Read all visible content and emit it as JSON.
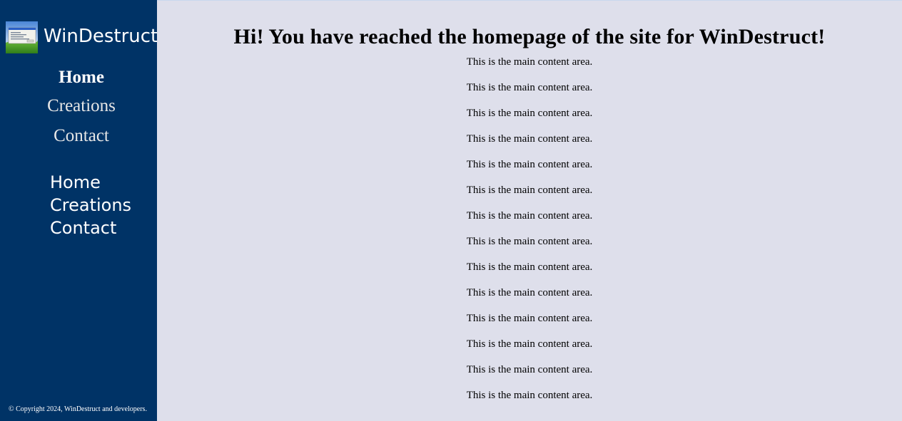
{
  "sidebar": {
    "brand_name": "WinDestruct",
    "logo_icon": "windows-xp-desktop-screenshot-logo",
    "background": "#003366",
    "nav_primary": [
      {
        "label": "Home",
        "active": true
      },
      {
        "label": "Creations",
        "active": false
      },
      {
        "label": "Contact",
        "active": false
      }
    ],
    "nav_secondary": [
      {
        "label": "Home"
      },
      {
        "label": "Creations"
      },
      {
        "label": "Contact"
      }
    ],
    "copyright": "© Copyright 2024, WinDestruct and developers."
  },
  "main": {
    "background": "#dedfeb",
    "heading": "Hi! You have reached the homepage of the site for WinDestruct!",
    "paragraphs": [
      "This is the main content area.",
      "This is the main content area.",
      "This is the main content area.",
      "This is the main content area.",
      "This is the main content area.",
      "This is the main content area.",
      "This is the main content area.",
      "This is the main content area.",
      "This is the main content area.",
      "This is the main content area.",
      "This is the main content area.",
      "This is the main content area.",
      "This is the main content area.",
      "This is the main content area."
    ]
  }
}
